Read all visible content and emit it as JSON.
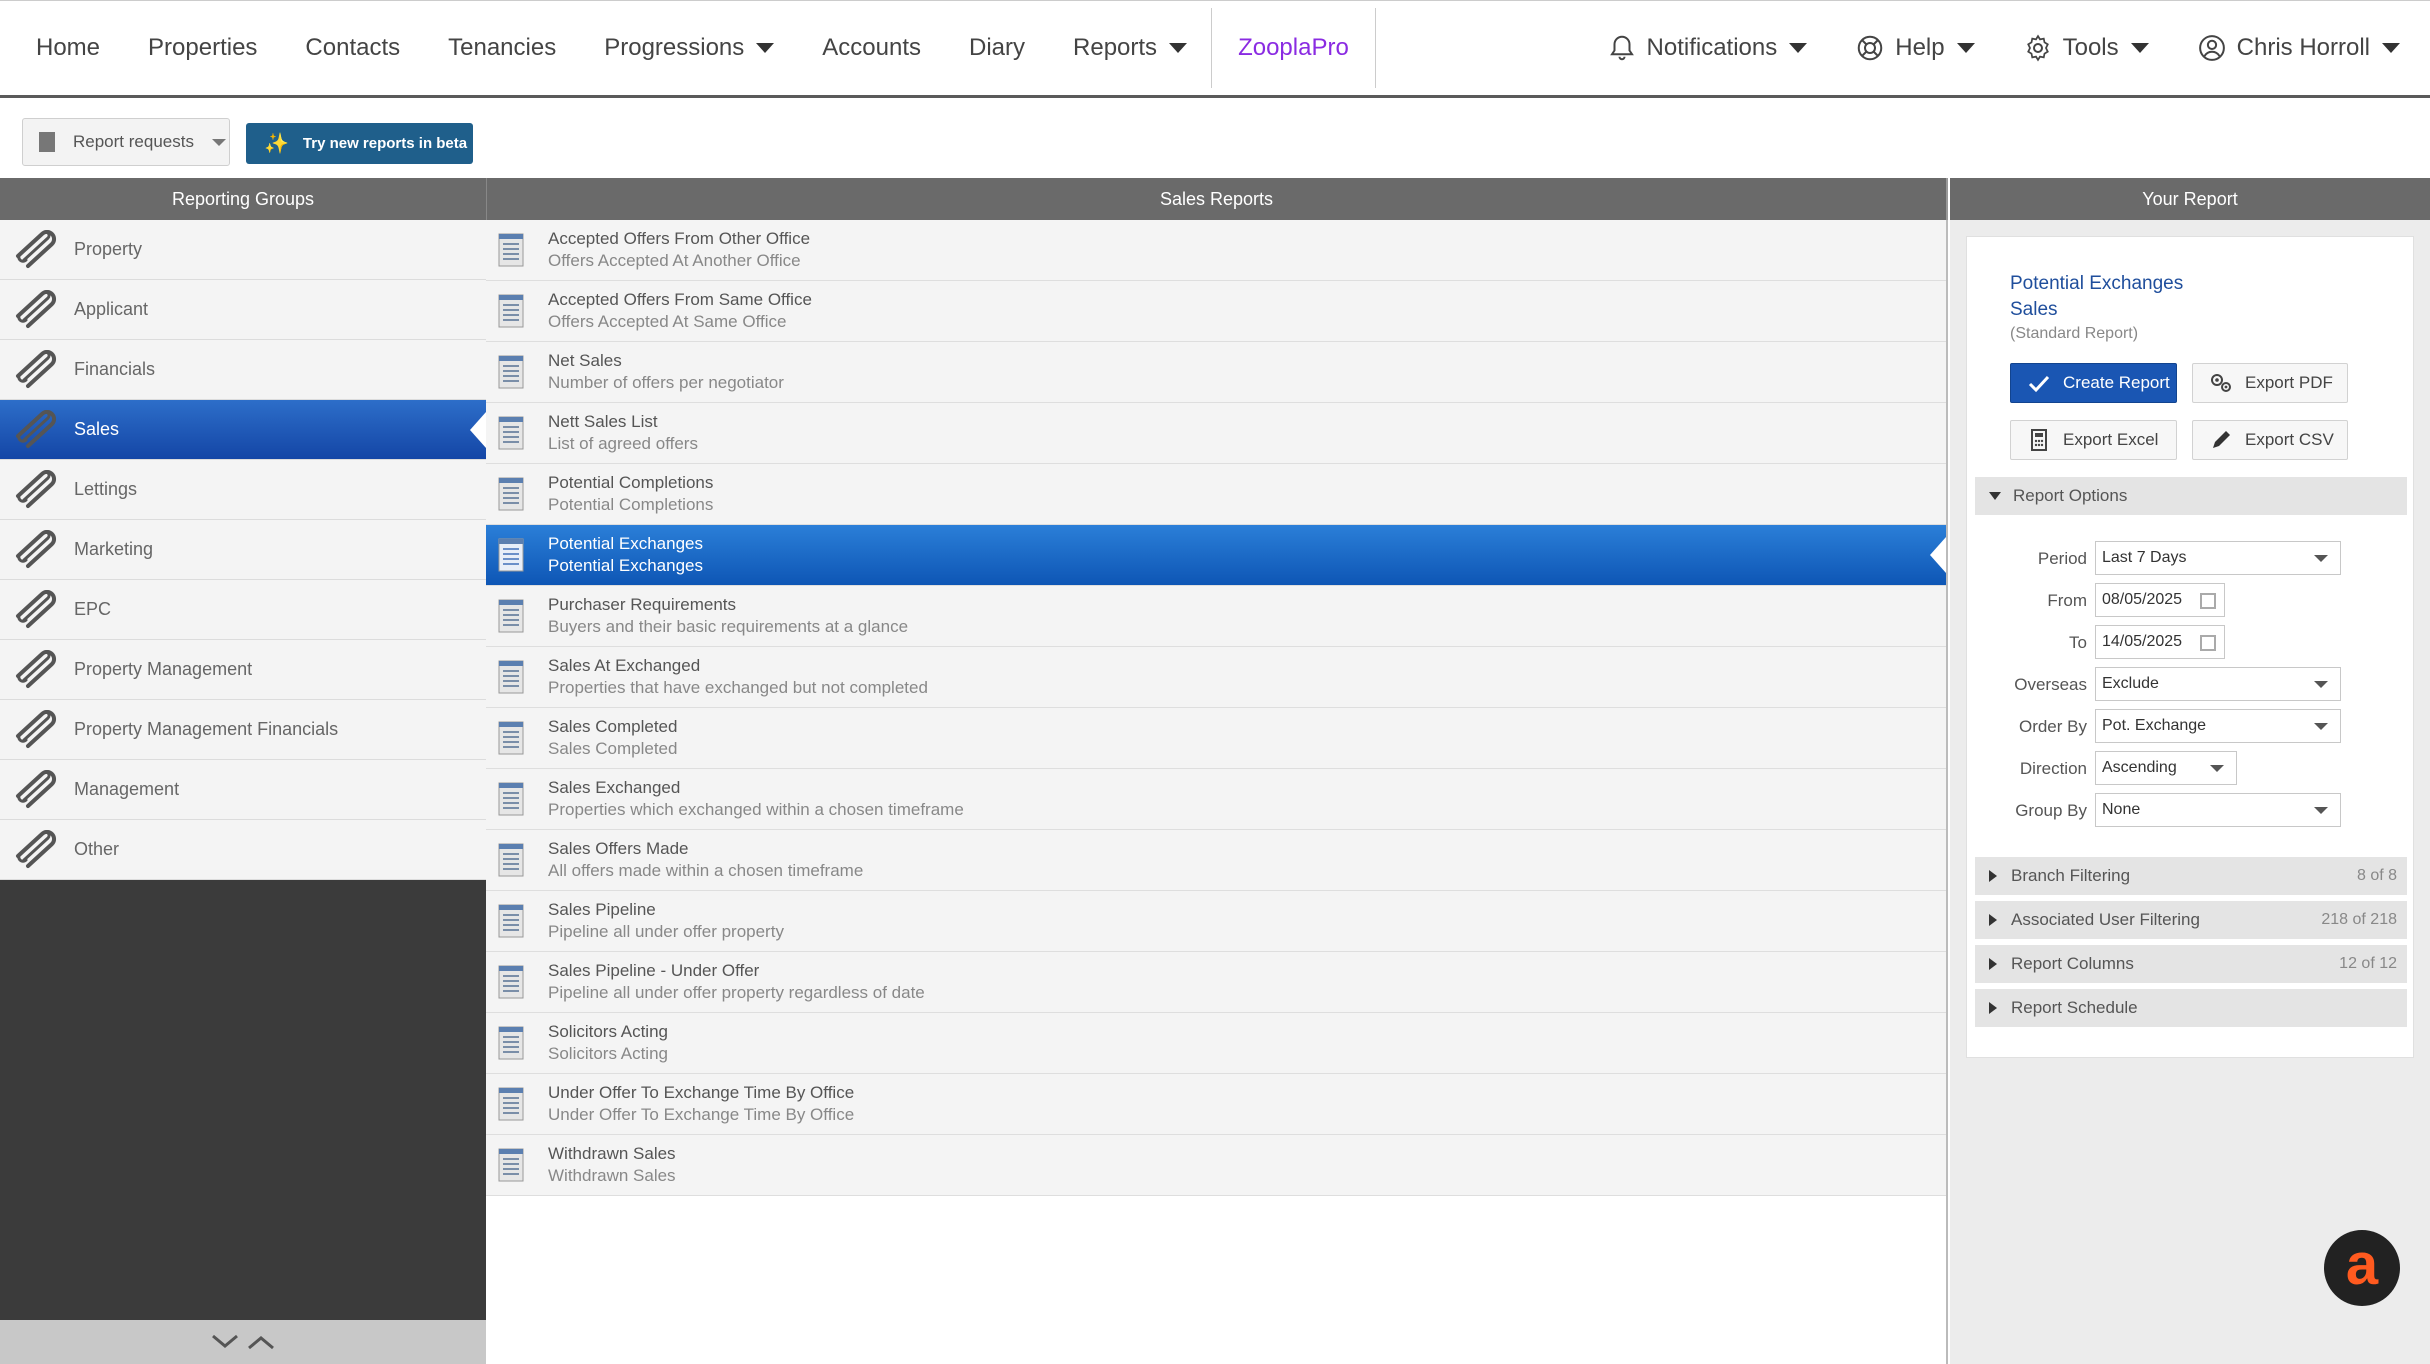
{
  "nav": {
    "items": [
      {
        "label": "Home",
        "name": "nav-home",
        "caret": false
      },
      {
        "label": "Properties",
        "name": "nav-properties",
        "caret": false
      },
      {
        "label": "Contacts",
        "name": "nav-contacts",
        "caret": false
      },
      {
        "label": "Tenancies",
        "name": "nav-tenancies",
        "caret": false
      },
      {
        "label": "Progressions",
        "name": "nav-progressions",
        "caret": true
      },
      {
        "label": "Accounts",
        "name": "nav-accounts",
        "caret": false
      },
      {
        "label": "Diary",
        "name": "nav-diary",
        "caret": false
      },
      {
        "label": "Reports",
        "name": "nav-reports",
        "caret": true
      }
    ],
    "zoopla": "ZooplaPro",
    "notifications": "Notifications",
    "help": "Help",
    "tools": "Tools",
    "user": "Chris Horroll"
  },
  "toolbar": {
    "report_requests": "Report requests",
    "beta": "Try new reports in beta"
  },
  "headers": {
    "left": "Reporting Groups",
    "middle": "Sales Reports",
    "right": "Your Report"
  },
  "groups": [
    {
      "label": "Property",
      "active": false
    },
    {
      "label": "Applicant",
      "active": false
    },
    {
      "label": "Financials",
      "active": false
    },
    {
      "label": "Sales",
      "active": true
    },
    {
      "label": "Lettings",
      "active": false
    },
    {
      "label": "Marketing",
      "active": false
    },
    {
      "label": "EPC",
      "active": false
    },
    {
      "label": "Property Management",
      "active": false
    },
    {
      "label": "Property Management Financials",
      "active": false
    },
    {
      "label": "Management",
      "active": false
    },
    {
      "label": "Other",
      "active": false
    }
  ],
  "reports": [
    {
      "title": "Accepted Offers From Other Office",
      "sub": "Offers Accepted At Another Office",
      "active": false
    },
    {
      "title": "Accepted Offers From Same Office",
      "sub": "Offers Accepted At Same Office",
      "active": false
    },
    {
      "title": "Net Sales",
      "sub": "Number of offers per negotiator",
      "active": false
    },
    {
      "title": "Nett Sales List",
      "sub": "List of agreed offers",
      "active": false
    },
    {
      "title": "Potential Completions",
      "sub": "Potential Completions",
      "active": false
    },
    {
      "title": "Potential Exchanges",
      "sub": "Potential Exchanges",
      "active": true
    },
    {
      "title": "Purchaser Requirements",
      "sub": "Buyers and their basic requirements at a glance",
      "active": false
    },
    {
      "title": "Sales At Exchanged",
      "sub": "Properties that have exchanged but not completed",
      "active": false
    },
    {
      "title": "Sales Completed",
      "sub": "Sales Completed",
      "active": false
    },
    {
      "title": "Sales Exchanged",
      "sub": "Properties which exchanged within a chosen timeframe",
      "active": false
    },
    {
      "title": "Sales Offers Made",
      "sub": "All offers made within a chosen timeframe",
      "active": false
    },
    {
      "title": "Sales Pipeline",
      "sub": "Pipeline all under offer property",
      "active": false
    },
    {
      "title": "Sales Pipeline - Under Offer",
      "sub": "Pipeline all under offer property regardless of date",
      "active": false
    },
    {
      "title": "Solicitors Acting",
      "sub": "Solicitors Acting",
      "active": false
    },
    {
      "title": "Under Offer To Exchange Time By Office",
      "sub": "Under Offer To Exchange Time By Office",
      "active": false
    },
    {
      "title": "Withdrawn Sales",
      "sub": "Withdrawn Sales",
      "active": false
    }
  ],
  "your_report": {
    "title_line1": "Potential Exchanges",
    "title_line2": "Sales",
    "kind": "(Standard Report)",
    "create": "Create Report",
    "export_pdf": "Export PDF",
    "export_excel": "Export Excel",
    "export_csv": "Export CSV",
    "options_title": "Report Options",
    "period_label": "Period",
    "period_value": "Last 7 Days",
    "from_label": "From",
    "from_value": "08/05/2025",
    "to_label": "To",
    "to_value": "14/05/2025",
    "overseas_label": "Overseas",
    "overseas_value": "Exclude",
    "order_label": "Order By",
    "order_value": "Pot. Exchange",
    "direction_label": "Direction",
    "direction_value": "Ascending",
    "group_label": "Group By",
    "group_value": "None",
    "sections": [
      {
        "label": "Branch Filtering",
        "count": "8 of 8"
      },
      {
        "label": "Associated User Filtering",
        "count": "218 of 218"
      },
      {
        "label": "Report Columns",
        "count": "12 of 12"
      },
      {
        "label": "Report Schedule",
        "count": ""
      }
    ]
  },
  "help_bubble": "a"
}
